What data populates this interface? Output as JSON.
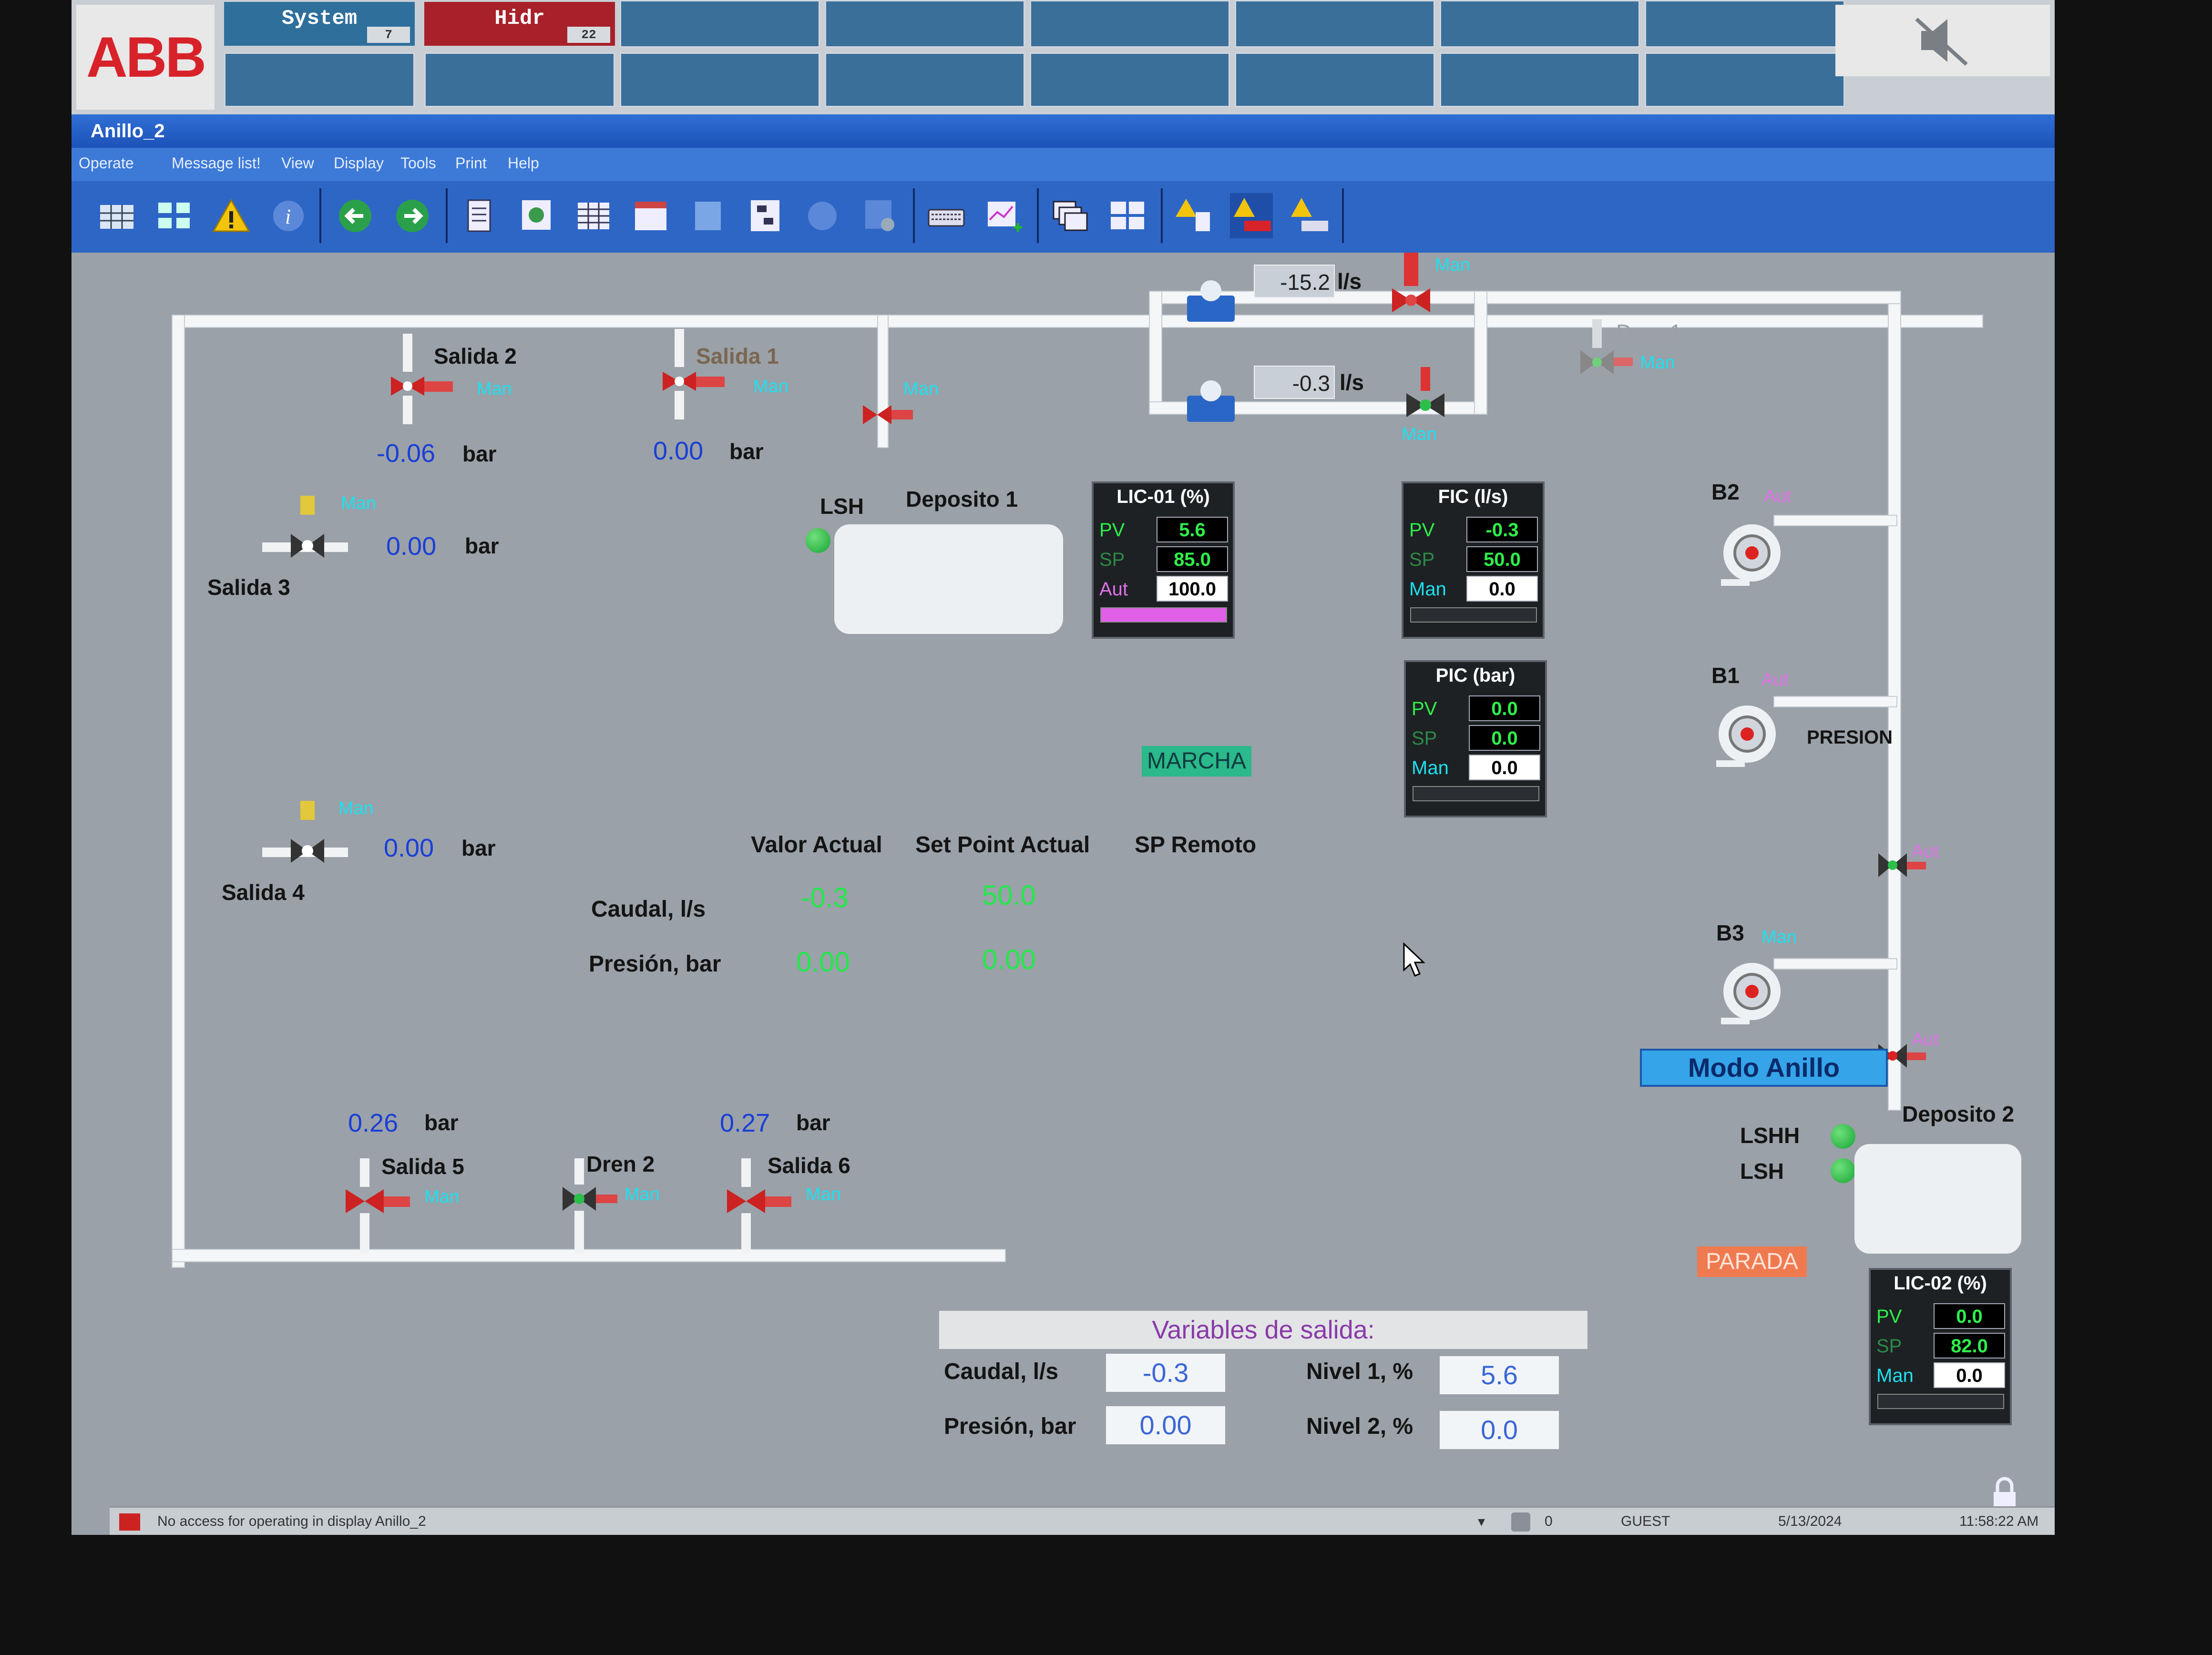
{
  "alarm_bar": {
    "logo": "ABB",
    "tabs": [
      {
        "label": "System",
        "count": "7",
        "color": "#2f6f9c"
      },
      {
        "label": "Hidr",
        "count": "22",
        "color": "#a8202a"
      }
    ]
  },
  "window": {
    "title": "Anillo_2",
    "menu": [
      "Operate",
      "Message list!",
      "View",
      "Display",
      "Tools",
      "Print",
      "Help"
    ]
  },
  "process": {
    "outlets": {
      "salida2": {
        "label": "Salida 2",
        "mode": "Man",
        "pressure": "-0.06",
        "unit": "bar"
      },
      "salida1": {
        "label": "Salida 1",
        "mode": "Man",
        "pressure": "0.00",
        "unit": "bar"
      },
      "salida3": {
        "label": "Salida 3",
        "mode": "Man",
        "pressure": "0.00",
        "unit": "bar"
      },
      "salida4": {
        "label": "Salida 4",
        "mode": "Man",
        "pressure": "0.00",
        "unit": "bar"
      },
      "salida5": {
        "label": "Salida 5",
        "mode": "Man",
        "pressure": "0.26",
        "unit": "bar"
      },
      "salida6": {
        "label": "Salida 6",
        "mode": "Man",
        "pressure": "0.27",
        "unit": "bar"
      },
      "dren2": {
        "label": "Dren 2",
        "mode": "Man"
      },
      "dren1": {
        "label": "Dren 1",
        "mode": "Man"
      }
    },
    "deposito1_valve_mode": "Man",
    "flow_top": {
      "value": "-15.2",
      "unit": "l/s",
      "valve_mode": "Man"
    },
    "flow_bottom": {
      "value": "-0.3",
      "unit": "l/s",
      "valve_mode": "Man"
    },
    "deposito1": {
      "label": "Deposito 1",
      "lsh": "LSH"
    },
    "deposito2": {
      "label": "Deposito 2",
      "lshh": "LSHH",
      "lsh": "LSH"
    },
    "pumps": {
      "b2": {
        "label": "B2",
        "mode": "Aut"
      },
      "b1": {
        "label": "B1",
        "mode": "Aut",
        "tag": "PRESION"
      },
      "b3": {
        "label": "B3",
        "mode": "Man"
      }
    },
    "right_valves": [
      {
        "mode": "Aut"
      },
      {
        "mode": "Aut"
      }
    ],
    "status_run": "MARCHA",
    "status_stop": "PARADA",
    "ring_mode": "Modo Anillo"
  },
  "faceplates": {
    "lic01": {
      "title": "LIC-01 (%)",
      "pv_label": "PV",
      "pv": "5.6",
      "sp_label": "SP",
      "sp": "85.0",
      "out_label": "Aut",
      "out": "100.0",
      "out_fraction": 1.0
    },
    "fic": {
      "title": "FIC (l/s)",
      "pv_label": "PV",
      "pv": "-0.3",
      "sp_label": "SP",
      "sp": "50.0",
      "out_label": "Man",
      "out": "0.0",
      "out_fraction": 0.0
    },
    "pic": {
      "title": "PIC (bar)",
      "pv_label": "PV",
      "pv": "0.0",
      "sp_label": "SP",
      "sp": "0.0",
      "out_label": "Man",
      "out": "0.0",
      "out_fraction": 0.0
    },
    "lic02": {
      "title": "LIC-02 (%)",
      "pv_label": "PV",
      "pv": "0.0",
      "sp_label": "SP",
      "sp": "82.0",
      "out_label": "Man",
      "out": "0.0",
      "out_fraction": 0.0
    }
  },
  "summary": {
    "col_actual": "Valor Actual",
    "col_sp": "Set Point Actual",
    "col_remote": "SP Remoto",
    "row_flow": "Caudal, l/s",
    "row_pressure": "Presión, bar",
    "flow_actual": "-0.3",
    "flow_sp": "50.0",
    "pressure_actual": "0.00",
    "pressure_sp": "0.00"
  },
  "outputs": {
    "title": "Variables de salida:",
    "flow_label": "Caudal, l/s",
    "flow": "-0.3",
    "pressure_label": "Presión, bar",
    "pressure": "0.00",
    "level1_label": "Nivel 1, %",
    "level1": "5.6",
    "level2_label": "Nivel 2, %",
    "level2": "0.0"
  },
  "statusbar": {
    "message": "No access for operating in display Anillo_2",
    "count": "0",
    "user": "GUEST",
    "date": "5/13/2024",
    "time": "11:58:22 AM"
  },
  "colors": {
    "pv_text": "#2ef04a",
    "man_text": "#1ee0f0",
    "aut_text": "#e070e8",
    "lic01_bar": "#e060e8"
  }
}
